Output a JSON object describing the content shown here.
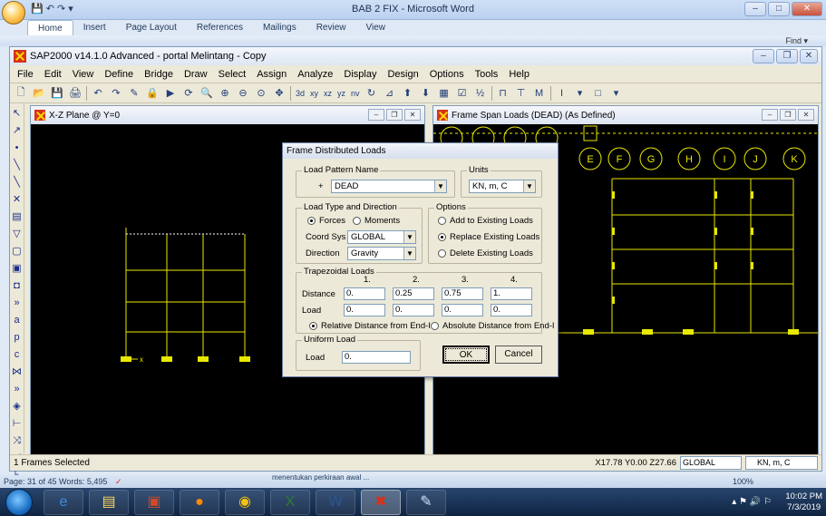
{
  "word": {
    "title": "BAB 2 FIX - Microsoft Word",
    "tabs": [
      "Home",
      "Insert",
      "Page Layout",
      "References",
      "Mailings",
      "Review",
      "View"
    ],
    "find": "Find ▾",
    "status": "Page: 31 of 45   Words: 5,495",
    "zoom": "100%",
    "remnant": "menentukan perkiraan awal ..."
  },
  "sap": {
    "title": "SAP2000 v14.1.0 Advanced  - portal Melintang - Copy",
    "menu": [
      "File",
      "Edit",
      "View",
      "Define",
      "Bridge",
      "Draw",
      "Select",
      "Assign",
      "Analyze",
      "Display",
      "Design",
      "Options",
      "Tools",
      "Help"
    ],
    "toolbar_text": [
      "3d",
      "xy",
      "xz",
      "yz",
      "nv"
    ],
    "status_left": "1 Frames Selected",
    "status_coords": "X17.78  Y0.00  Z27.66",
    "status_cs": "GLOBAL",
    "status_units": "KN, m, C"
  },
  "left_window": {
    "title": "X-Z Plane @ Y=0",
    "axis_label": "x"
  },
  "right_window": {
    "title": "Frame Span Loads (DEAD) (As Defined)",
    "gridline_labels": [
      "E",
      "F",
      "G",
      "H",
      "I",
      "J",
      "K"
    ]
  },
  "dialog": {
    "title": "Frame Distributed Loads",
    "load_pattern_group": "Load Pattern Name",
    "load_pattern_plus": "+",
    "load_pattern_value": "DEAD",
    "units_group": "Units",
    "units_value": "KN, m, C",
    "load_type_group": "Load Type and Direction",
    "forces_label": "Forces",
    "moments_label": "Moments",
    "coord_sys_label": "Coord Sys",
    "coord_sys_value": "GLOBAL",
    "direction_label": "Direction",
    "direction_value": "Gravity",
    "options_group": "Options",
    "opt_add": "Add to Existing Loads",
    "opt_replace": "Replace Existing Loads",
    "opt_delete": "Delete Existing Loads",
    "trap_group": "Trapezoidal Loads",
    "col_headers": [
      "1.",
      "2.",
      "3.",
      "4."
    ],
    "distance_label": "Distance",
    "distance_values": [
      "0.",
      "0.25",
      "0.75",
      "1."
    ],
    "load_label": "Load",
    "load_values": [
      "0.",
      "0.",
      "0.",
      "0."
    ],
    "rel_dist": "Relative Distance from End-I",
    "abs_dist": "Absolute Distance from End-I",
    "uniform_group": "Uniform Load",
    "uniform_load_label": "Load",
    "uniform_load_value": "0.",
    "ok_label": "OK",
    "cancel_label": "Cancel"
  },
  "taskbar": {
    "time": "10:02 PM",
    "date": "7/3/2019"
  },
  "colors": {
    "frame": "#e8e800",
    "load": "#e8e800",
    "background": "#000000"
  }
}
